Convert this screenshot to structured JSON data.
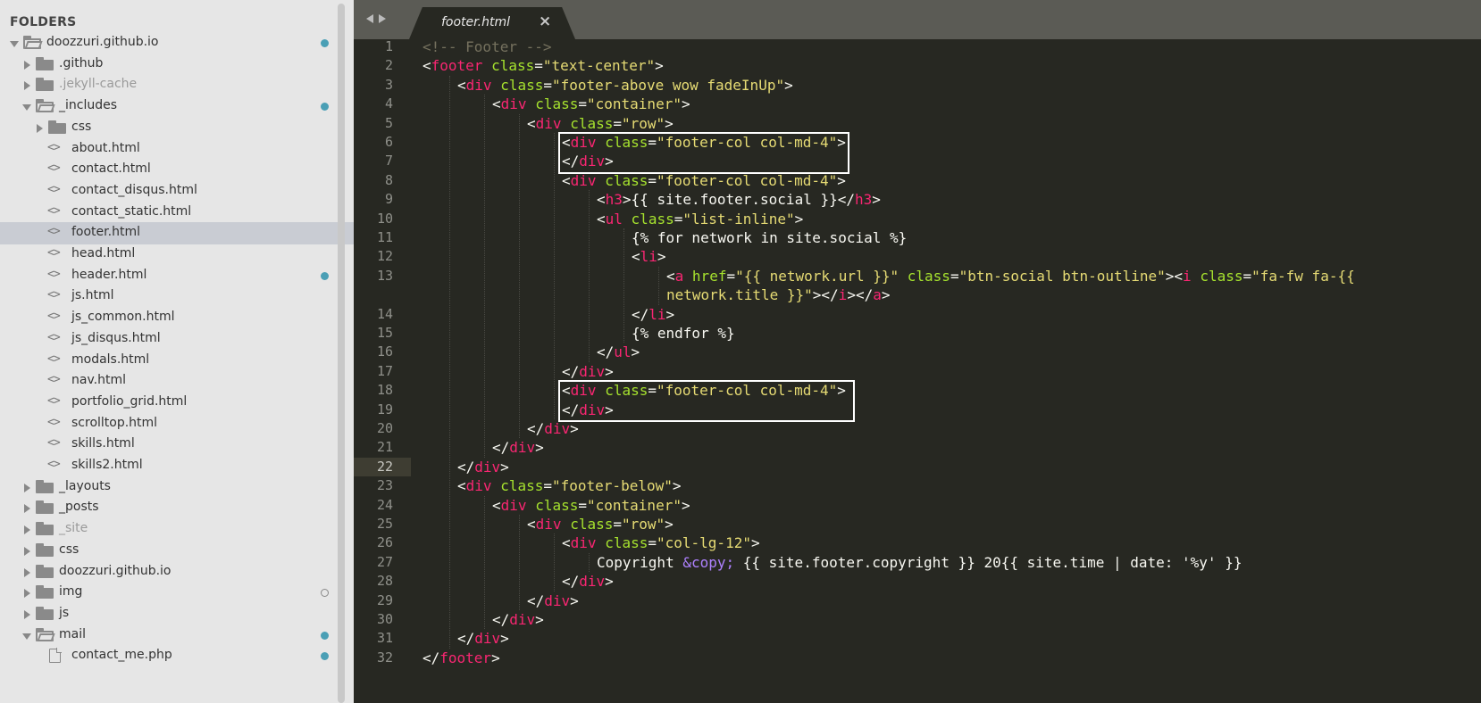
{
  "sidebar": {
    "header": "FOLDERS",
    "tree": [
      {
        "label": "doozzuri.github.io",
        "kind": "folder-open",
        "depth": 0,
        "dot": "blue"
      },
      {
        "label": ".github",
        "kind": "folder",
        "depth": 1
      },
      {
        "label": ".jekyll-cache",
        "kind": "folder",
        "depth": 1,
        "dim": true
      },
      {
        "label": "_includes",
        "kind": "folder-open",
        "depth": 1,
        "dot": "blue"
      },
      {
        "label": "css",
        "kind": "folder",
        "depth": 2
      },
      {
        "label": "about.html",
        "kind": "code",
        "depth": 2
      },
      {
        "label": "contact.html",
        "kind": "code",
        "depth": 2
      },
      {
        "label": "contact_disqus.html",
        "kind": "code",
        "depth": 2
      },
      {
        "label": "contact_static.html",
        "kind": "code",
        "depth": 2
      },
      {
        "label": "footer.html",
        "kind": "code",
        "depth": 2,
        "selected": true
      },
      {
        "label": "head.html",
        "kind": "code",
        "depth": 2
      },
      {
        "label": "header.html",
        "kind": "code",
        "depth": 2,
        "dot": "blue"
      },
      {
        "label": "js.html",
        "kind": "code",
        "depth": 2
      },
      {
        "label": "js_common.html",
        "kind": "code",
        "depth": 2
      },
      {
        "label": "js_disqus.html",
        "kind": "code",
        "depth": 2
      },
      {
        "label": "modals.html",
        "kind": "code",
        "depth": 2
      },
      {
        "label": "nav.html",
        "kind": "code",
        "depth": 2
      },
      {
        "label": "portfolio_grid.html",
        "kind": "code",
        "depth": 2
      },
      {
        "label": "scrolltop.html",
        "kind": "code",
        "depth": 2
      },
      {
        "label": "skills.html",
        "kind": "code",
        "depth": 2
      },
      {
        "label": "skills2.html",
        "kind": "code",
        "depth": 2
      },
      {
        "label": "_layouts",
        "kind": "folder",
        "depth": 1
      },
      {
        "label": "_posts",
        "kind": "folder",
        "depth": 1
      },
      {
        "label": "_site",
        "kind": "folder",
        "depth": 1,
        "dim": true
      },
      {
        "label": "css",
        "kind": "folder",
        "depth": 1
      },
      {
        "label": "doozzuri.github.io",
        "kind": "folder",
        "depth": 1
      },
      {
        "label": "img",
        "kind": "folder",
        "depth": 1,
        "dot": "hollow"
      },
      {
        "label": "js",
        "kind": "folder",
        "depth": 1
      },
      {
        "label": "mail",
        "kind": "folder-open",
        "depth": 1,
        "dot": "blue"
      },
      {
        "label": "contact_me.php",
        "kind": "file",
        "depth": 2,
        "dot": "blue"
      }
    ]
  },
  "tabs": [
    {
      "label": "footer.html",
      "active": true,
      "close_glyph": "×"
    }
  ],
  "editor": {
    "current_line": 22,
    "lines": [
      {
        "n": "1",
        "indent": 1,
        "tokens": [
          [
            "c",
            "<!-- Footer -->"
          ]
        ]
      },
      {
        "n": "2",
        "indent": 1,
        "tokens": [
          [
            "p",
            "<"
          ],
          [
            "t",
            "footer"
          ],
          [
            "p",
            " "
          ],
          [
            "a",
            "class"
          ],
          [
            "p",
            "="
          ],
          [
            "s",
            "\"text-center\""
          ],
          [
            "p",
            ">"
          ]
        ]
      },
      {
        "n": "3",
        "indent": 2,
        "tokens": [
          [
            "p",
            "<"
          ],
          [
            "t",
            "div"
          ],
          [
            "p",
            " "
          ],
          [
            "a",
            "class"
          ],
          [
            "p",
            "="
          ],
          [
            "s",
            "\"footer-above wow fadeInUp\""
          ],
          [
            "p",
            ">"
          ]
        ]
      },
      {
        "n": "4",
        "indent": 3,
        "tokens": [
          [
            "p",
            "<"
          ],
          [
            "t",
            "div"
          ],
          [
            "p",
            " "
          ],
          [
            "a",
            "class"
          ],
          [
            "p",
            "="
          ],
          [
            "s",
            "\"container\""
          ],
          [
            "p",
            ">"
          ]
        ]
      },
      {
        "n": "5",
        "indent": 4,
        "tokens": [
          [
            "p",
            "<"
          ],
          [
            "t",
            "div"
          ],
          [
            "p",
            " "
          ],
          [
            "a",
            "class"
          ],
          [
            "p",
            "="
          ],
          [
            "s",
            "\"row\""
          ],
          [
            "p",
            ">"
          ]
        ]
      },
      {
        "n": "6",
        "indent": 5,
        "tokens": [
          [
            "p",
            "<"
          ],
          [
            "t",
            "div"
          ],
          [
            "p",
            " "
          ],
          [
            "a",
            "class"
          ],
          [
            "p",
            "="
          ],
          [
            "s",
            "\"footer-col col-md-4\""
          ],
          [
            "p",
            ">"
          ]
        ]
      },
      {
        "n": "7",
        "indent": 5,
        "tokens": [
          [
            "p",
            "</"
          ],
          [
            "t",
            "div"
          ],
          [
            "p",
            ">"
          ]
        ]
      },
      {
        "n": "8",
        "indent": 5,
        "tokens": [
          [
            "p",
            "<"
          ],
          [
            "t",
            "div"
          ],
          [
            "p",
            " "
          ],
          [
            "a",
            "class"
          ],
          [
            "p",
            "="
          ],
          [
            "s",
            "\"footer-col col-md-4\""
          ],
          [
            "p",
            ">"
          ]
        ]
      },
      {
        "n": "9",
        "indent": 6,
        "tokens": [
          [
            "p",
            "<"
          ],
          [
            "t",
            "h3"
          ],
          [
            "p",
            ">{{ site.footer.social }}</"
          ],
          [
            "t",
            "h3"
          ],
          [
            "p",
            ">"
          ]
        ]
      },
      {
        "n": "10",
        "indent": 6,
        "tokens": [
          [
            "p",
            "<"
          ],
          [
            "t",
            "ul"
          ],
          [
            "p",
            " "
          ],
          [
            "a",
            "class"
          ],
          [
            "p",
            "="
          ],
          [
            "s",
            "\"list-inline\""
          ],
          [
            "p",
            ">"
          ]
        ]
      },
      {
        "n": "11",
        "indent": 7,
        "tokens": [
          [
            "p",
            "{% for network in site.social %}"
          ]
        ]
      },
      {
        "n": "12",
        "indent": 7,
        "tokens": [
          [
            "p",
            "<"
          ],
          [
            "t",
            "li"
          ],
          [
            "p",
            ">"
          ]
        ]
      },
      {
        "n": "13",
        "indent": 8,
        "tokens": [
          [
            "p",
            "<"
          ],
          [
            "t",
            "a"
          ],
          [
            "p",
            " "
          ],
          [
            "a",
            "href"
          ],
          [
            "p",
            "="
          ],
          [
            "s",
            "\"{{ network.url }}\""
          ],
          [
            "p",
            " "
          ],
          [
            "a",
            "class"
          ],
          [
            "p",
            "="
          ],
          [
            "s",
            "\"btn-social btn-outline\""
          ],
          [
            "p",
            "><"
          ],
          [
            "t",
            "i"
          ],
          [
            "p",
            " "
          ],
          [
            "a",
            "class"
          ],
          [
            "p",
            "="
          ],
          [
            "s",
            "\"fa-fw fa-{{"
          ]
        ]
      },
      {
        "n": "",
        "indent": 8,
        "tokens": [
          [
            "s",
            "network.title }}\""
          ],
          [
            "p",
            "></"
          ],
          [
            "t",
            "i"
          ],
          [
            "p",
            "></"
          ],
          [
            "t",
            "a"
          ],
          [
            "p",
            ">"
          ]
        ]
      },
      {
        "n": "14",
        "indent": 7,
        "tokens": [
          [
            "p",
            "</"
          ],
          [
            "t",
            "li"
          ],
          [
            "p",
            ">"
          ]
        ]
      },
      {
        "n": "15",
        "indent": 7,
        "tokens": [
          [
            "p",
            "{% endfor %}"
          ]
        ]
      },
      {
        "n": "16",
        "indent": 6,
        "tokens": [
          [
            "p",
            "</"
          ],
          [
            "t",
            "ul"
          ],
          [
            "p",
            ">"
          ]
        ]
      },
      {
        "n": "17",
        "indent": 5,
        "tokens": [
          [
            "p",
            "</"
          ],
          [
            "t",
            "div"
          ],
          [
            "p",
            ">"
          ]
        ]
      },
      {
        "n": "18",
        "indent": 5,
        "tokens": [
          [
            "p",
            "<"
          ],
          [
            "t",
            "div"
          ],
          [
            "p",
            " "
          ],
          [
            "a",
            "class"
          ],
          [
            "p",
            "="
          ],
          [
            "s",
            "\"footer-col col-md-4\""
          ],
          [
            "p",
            ">"
          ]
        ]
      },
      {
        "n": "19",
        "indent": 5,
        "tokens": [
          [
            "p",
            "</"
          ],
          [
            "t",
            "div"
          ],
          [
            "p",
            ">"
          ]
        ]
      },
      {
        "n": "20",
        "indent": 4,
        "tokens": [
          [
            "p",
            "</"
          ],
          [
            "t",
            "div"
          ],
          [
            "p",
            ">"
          ]
        ]
      },
      {
        "n": "21",
        "indent": 3,
        "tokens": [
          [
            "p",
            "</"
          ],
          [
            "t",
            "div"
          ],
          [
            "p",
            ">"
          ]
        ]
      },
      {
        "n": "22",
        "indent": 2,
        "tokens": [
          [
            "p",
            "</"
          ],
          [
            "t",
            "div"
          ],
          [
            "p",
            ">"
          ]
        ]
      },
      {
        "n": "23",
        "indent": 2,
        "tokens": [
          [
            "p",
            "<"
          ],
          [
            "t",
            "div"
          ],
          [
            "p",
            " "
          ],
          [
            "a",
            "class"
          ],
          [
            "p",
            "="
          ],
          [
            "s",
            "\"footer-below\""
          ],
          [
            "p",
            ">"
          ]
        ]
      },
      {
        "n": "24",
        "indent": 3,
        "tokens": [
          [
            "p",
            "<"
          ],
          [
            "t",
            "div"
          ],
          [
            "p",
            " "
          ],
          [
            "a",
            "class"
          ],
          [
            "p",
            "="
          ],
          [
            "s",
            "\"container\""
          ],
          [
            "p",
            ">"
          ]
        ]
      },
      {
        "n": "25",
        "indent": 4,
        "tokens": [
          [
            "p",
            "<"
          ],
          [
            "t",
            "div"
          ],
          [
            "p",
            " "
          ],
          [
            "a",
            "class"
          ],
          [
            "p",
            "="
          ],
          [
            "s",
            "\"row\""
          ],
          [
            "p",
            ">"
          ]
        ]
      },
      {
        "n": "26",
        "indent": 5,
        "tokens": [
          [
            "p",
            "<"
          ],
          [
            "t",
            "div"
          ],
          [
            "p",
            " "
          ],
          [
            "a",
            "class"
          ],
          [
            "p",
            "="
          ],
          [
            "s",
            "\"col-lg-12\""
          ],
          [
            "p",
            ">"
          ]
        ]
      },
      {
        "n": "27",
        "indent": 6,
        "tokens": [
          [
            "p",
            "Copyright "
          ],
          [
            "e",
            "&copy;"
          ],
          [
            "p",
            " {{ site.footer.copyright }} 20{{ site.time | date: '%y' }}"
          ]
        ]
      },
      {
        "n": "28",
        "indent": 5,
        "tokens": [
          [
            "p",
            "</"
          ],
          [
            "t",
            "div"
          ],
          [
            "p",
            ">"
          ]
        ]
      },
      {
        "n": "29",
        "indent": 4,
        "tokens": [
          [
            "p",
            "</"
          ],
          [
            "t",
            "div"
          ],
          [
            "p",
            ">"
          ]
        ]
      },
      {
        "n": "30",
        "indent": 3,
        "tokens": [
          [
            "p",
            "</"
          ],
          [
            "t",
            "div"
          ],
          [
            "p",
            ">"
          ]
        ]
      },
      {
        "n": "31",
        "indent": 2,
        "tokens": [
          [
            "p",
            "</"
          ],
          [
            "t",
            "div"
          ],
          [
            "p",
            ">"
          ]
        ]
      },
      {
        "n": "32",
        "indent": 1,
        "tokens": [
          [
            "p",
            "</"
          ],
          [
            "t",
            "footer"
          ],
          [
            "p",
            ">"
          ]
        ]
      }
    ]
  },
  "colors": {
    "editor_bg": "#272822",
    "tag": "#f92672",
    "attr": "#a6e22e",
    "string": "#e6db74",
    "comment": "#75715e",
    "entity": "#ae81ff",
    "text": "#f8f8f2",
    "sidebar_bg": "#e6e6e6",
    "selected_row": "#c9ccd3",
    "modified_dot": "#4a9fb5"
  }
}
